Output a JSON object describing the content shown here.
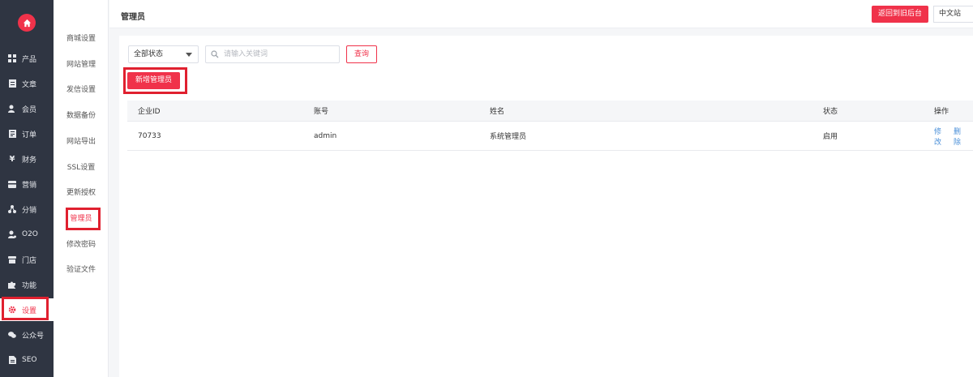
{
  "nav": {
    "items": [
      {
        "label": "产品",
        "icon": "grid-icon"
      },
      {
        "label": "文章",
        "icon": "document-icon"
      },
      {
        "label": "会员",
        "icon": "user-icon"
      },
      {
        "label": "订单",
        "icon": "list-icon"
      },
      {
        "label": "财务",
        "icon": "yen-icon"
      },
      {
        "label": "营销",
        "icon": "card-icon"
      },
      {
        "label": "分销",
        "icon": "share-icon"
      },
      {
        "label": "O2O",
        "icon": "o2o-icon"
      },
      {
        "label": "门店",
        "icon": "store-icon"
      },
      {
        "label": "功能",
        "icon": "puzzle-icon"
      },
      {
        "label": "设置",
        "icon": "gear-icon"
      },
      {
        "label": "公众号",
        "icon": "wechat-icon"
      },
      {
        "label": "SEO",
        "icon": "seo-doc-icon"
      }
    ],
    "active_index": 10
  },
  "subnav": {
    "items": [
      "商城设置",
      "网站管理",
      "发信设置",
      "数据备份",
      "网站导出",
      "SSL设置",
      "更新授权",
      "管理员",
      "修改密码",
      "验证文件"
    ],
    "active_index": 7
  },
  "header": {
    "title": "管理员",
    "back_label": "返回到旧后台",
    "lang": "中文站"
  },
  "filters": {
    "status_value": "全部状态",
    "search_placeholder": "请输入关键词",
    "query_label": "查询"
  },
  "actions": {
    "add_label": "新增管理员"
  },
  "table": {
    "columns": [
      "企业ID",
      "账号",
      "姓名",
      "状态",
      "操作"
    ],
    "rows": [
      {
        "id": "70733",
        "account": "admin",
        "name": "系统管理员",
        "status": "启用",
        "edit": "修改",
        "delete": "删除"
      }
    ]
  },
  "colors": {
    "accent": "#f0324a",
    "nav_bg": "#2f3542",
    "link": "#4a8fd8",
    "highlight": "#e0202f"
  }
}
